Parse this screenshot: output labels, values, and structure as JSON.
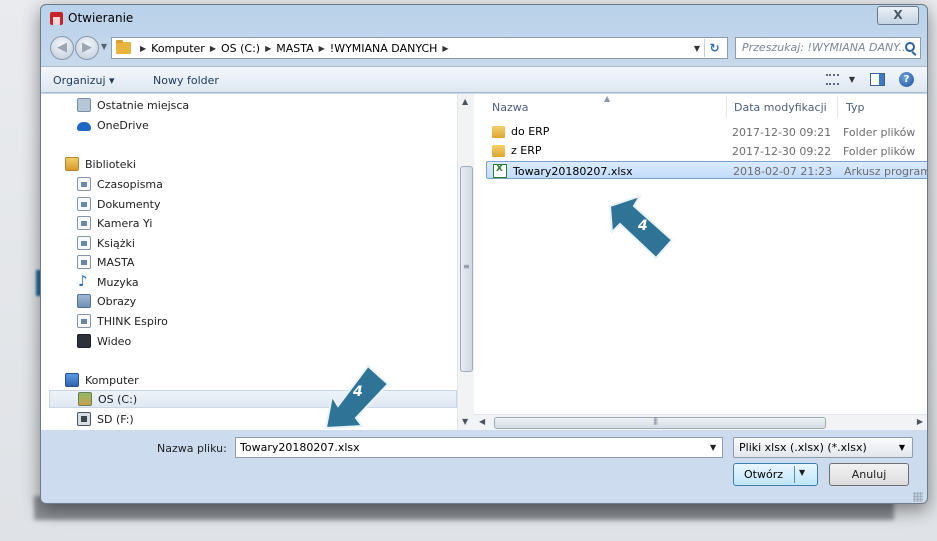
{
  "window": {
    "title": "Otwieranie",
    "close_glyph": "X"
  },
  "address": {
    "breadcrumbs": [
      "Komputer",
      "OS (C:)",
      "MASTA",
      "!WYMIANA DANYCH"
    ],
    "search_placeholder": "Przeszukaj: !WYMIANA DANY..."
  },
  "toolbar": {
    "organize_label": "Organizuj ▾",
    "new_folder_label": "Nowy folder"
  },
  "nav": {
    "items": [
      {
        "label": "Ostatnie miejsca",
        "icon": "recent-places-icon"
      },
      {
        "label": "OneDrive",
        "icon": "onedrive-icon"
      },
      {
        "label": "Biblioteki",
        "icon": "libraries-icon"
      },
      {
        "label": "Czasopisma",
        "icon": "library-icon"
      },
      {
        "label": "Dokumenty",
        "icon": "documents-icon"
      },
      {
        "label": "Kamera Yi",
        "icon": "library-icon"
      },
      {
        "label": "Książki",
        "icon": "library-icon"
      },
      {
        "label": "MASTA",
        "icon": "library-icon"
      },
      {
        "label": "Muzyka",
        "icon": "music-icon"
      },
      {
        "label": "Obrazy",
        "icon": "pictures-icon"
      },
      {
        "label": "THINK Espiro",
        "icon": "library-icon"
      },
      {
        "label": "Wideo",
        "icon": "video-icon"
      },
      {
        "label": "Komputer",
        "icon": "computer-icon"
      },
      {
        "label": "OS (C:)",
        "icon": "drive-icon"
      },
      {
        "label": "SD (F:)",
        "icon": "sd-card-icon"
      }
    ]
  },
  "files": {
    "columns": [
      "Nazwa",
      "Data modyfikacji",
      "Typ"
    ],
    "rows": [
      {
        "name": "do ERP",
        "date": "2017-12-30 09:21",
        "type": "Folder plików",
        "icon": "folder-icon"
      },
      {
        "name": "z ERP",
        "date": "2017-12-30 09:22",
        "type": "Folder plików",
        "icon": "folder-icon"
      },
      {
        "name": "Towary20180207.xlsx",
        "date": "2018-02-07 21:23",
        "type": "Arkusz programu",
        "icon": "excel-file-icon"
      }
    ]
  },
  "bottom": {
    "filename_label": "Nazwa pliku:",
    "filename_value": "Towary20180207.xlsx",
    "filter_value": "Pliki xlsx (.xlsx) (*.xlsx)",
    "open_label": "Otwórz",
    "cancel_label": "Anuluj"
  },
  "callouts": [
    {
      "number": "4",
      "color": "#2d6f8e"
    },
    {
      "number": "4",
      "color": "#2d6f8e"
    }
  ]
}
